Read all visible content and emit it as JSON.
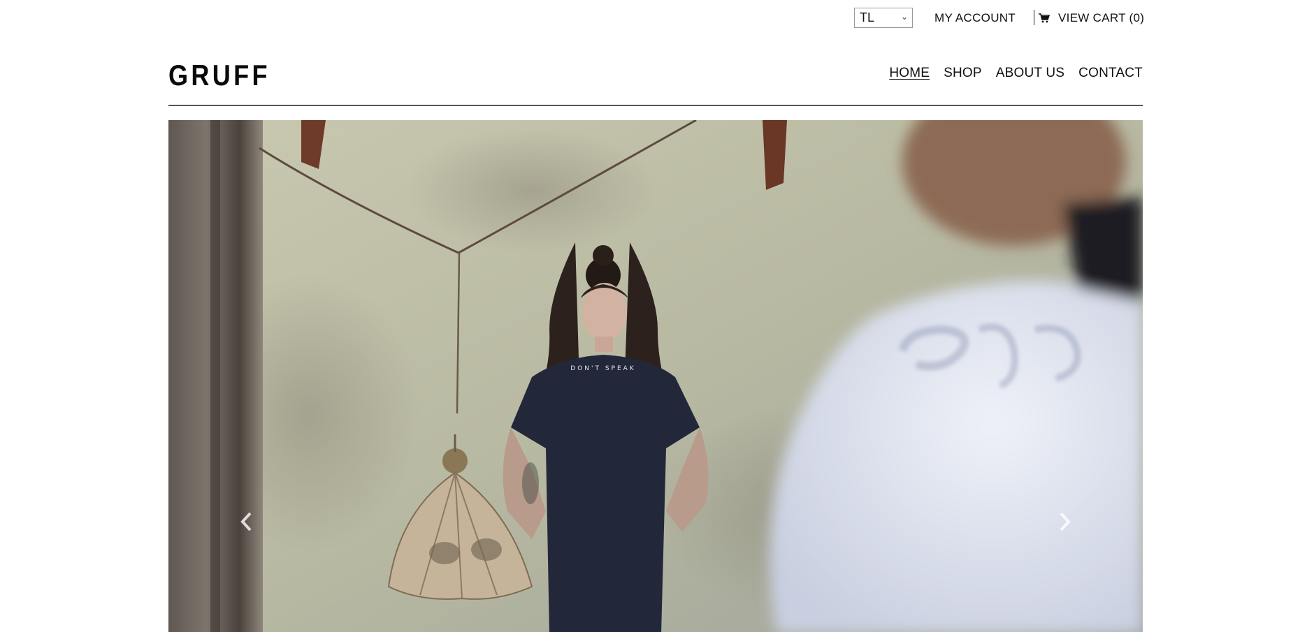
{
  "topbar": {
    "currency": "TL",
    "my_account": "MY ACCOUNT",
    "view_cart": "VIEW CART (0)"
  },
  "brand": {
    "logo_text": "GRUFF"
  },
  "nav": {
    "items": [
      {
        "label": "HOME",
        "active": true
      },
      {
        "label": "SHOP",
        "active": false
      },
      {
        "label": "ABOUT US",
        "active": false
      },
      {
        "label": "CONTACT",
        "active": false
      }
    ]
  },
  "hero": {
    "shirt_text": "DON'T SPEAK",
    "controls": {
      "prev_icon": "chevron-left-icon",
      "next_icon": "chevron-right-icon"
    }
  },
  "colors": {
    "text": "#111111",
    "rule": "#555555",
    "wall": "#b9b9a4"
  }
}
